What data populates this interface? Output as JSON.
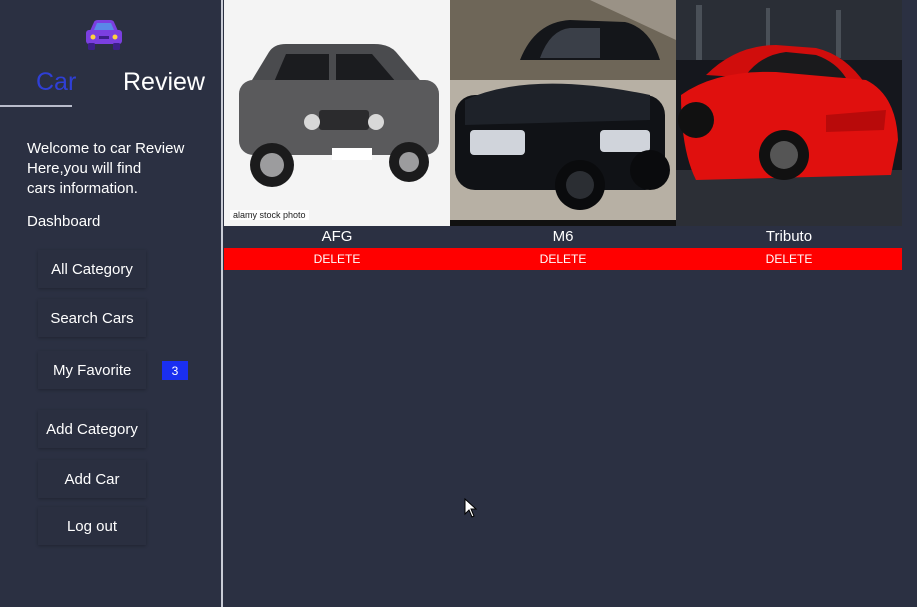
{
  "app": {
    "brand_left": "Car",
    "brand_right": "Review",
    "accent": "#2f3fd6",
    "logo_icon": "car-icon"
  },
  "sidebar": {
    "welcome_line1": "Welcome to car Review",
    "welcome_line2": "Here,you will find",
    "welcome_line3": "cars information.",
    "dashboard_label": "Dashboard",
    "items": [
      {
        "label": "All Category"
      },
      {
        "label": "Search Cars"
      },
      {
        "label": "My Favorite",
        "badge": "3"
      },
      {
        "label": "Add Category"
      },
      {
        "label": "Add Car"
      },
      {
        "label": "Log out"
      }
    ]
  },
  "cars": [
    {
      "name": "AFG",
      "delete_label": "DELETE",
      "color": "#5a5a5c",
      "watermark": "alamy stock photo"
    },
    {
      "name": "M6",
      "delete_label": "DELETE",
      "color": "#101216"
    },
    {
      "name": "Tributo",
      "delete_label": "DELETE",
      "color": "#e0100e"
    }
  ],
  "colors": {
    "background": "#2b3042",
    "delete": "#ff0000",
    "badge": "#1a2ff0"
  }
}
